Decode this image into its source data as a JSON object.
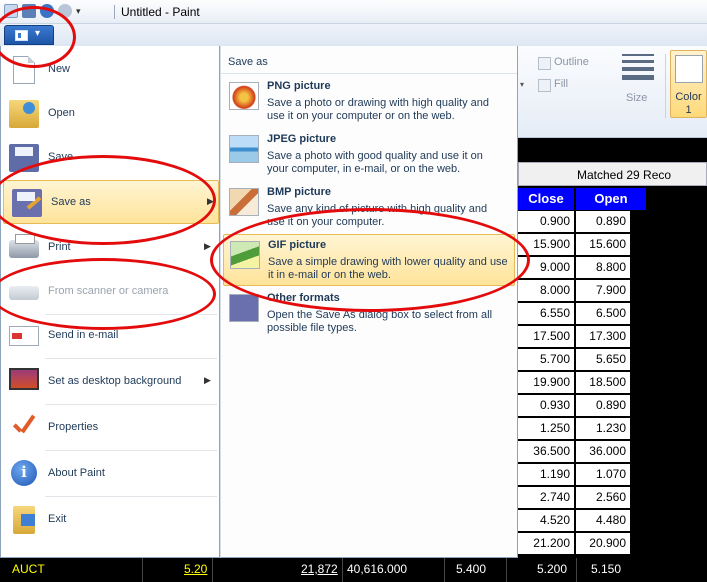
{
  "window": {
    "title": "Untitled - Paint"
  },
  "quick_access": {
    "icons": [
      "paint-doc-icon",
      "save-icon",
      "undo-icon",
      "redo-icon",
      "customize-arrow-icon"
    ]
  },
  "ribbon": {
    "outline_label": "Outline",
    "fill_label": "Fill",
    "size_label": "Size",
    "color1_label_line1": "Color",
    "color1_label_line2": "1"
  },
  "app_menu": {
    "items": [
      {
        "label": "New",
        "icon": "new-document-icon"
      },
      {
        "label": "Open",
        "icon": "open-folder-icon"
      },
      {
        "label": "Save",
        "icon": "save-icon"
      },
      {
        "label": "Save as",
        "icon": "save-as-icon",
        "selected": true,
        "submenu": true
      },
      {
        "label": "Print",
        "icon": "printer-icon",
        "submenu": true
      },
      {
        "label": "From scanner or camera",
        "icon": "scanner-icon",
        "disabled": true
      },
      {
        "label": "Send in e-mail",
        "icon": "email-icon"
      },
      {
        "label": "Set as desktop background",
        "icon": "desktop-icon",
        "submenu": true
      },
      {
        "label": "Properties",
        "icon": "checkmark-icon"
      },
      {
        "label": "About Paint",
        "icon": "info-icon"
      },
      {
        "label": "Exit",
        "icon": "exit-icon"
      }
    ]
  },
  "save_as": {
    "header": "Save as",
    "options": [
      {
        "title": "PNG picture",
        "description": "Save a photo or drawing with high quality and use it on your computer or on the web.",
        "icon": "png-picture-icon"
      },
      {
        "title": "JPEG picture",
        "description": "Save a photo with good quality and use it on your computer, in e-mail, or on the web.",
        "icon": "jpeg-picture-icon"
      },
      {
        "title": "BMP picture",
        "description": "Save any kind of picture with high quality and use it on your computer.",
        "icon": "bmp-picture-icon"
      },
      {
        "title": "GIF picture",
        "description": "Save a simple drawing with lower quality and use it in e-mail or on the web.",
        "icon": "gif-picture-icon",
        "selected": true
      },
      {
        "title": "Other formats",
        "description": "Open the Save As dialog box to select from all possible file types.",
        "icon": "other-formats-icon"
      }
    ]
  },
  "stock_table": {
    "matched_text": "Matched 29 Reco",
    "headers": [
      "Close",
      "Open"
    ],
    "rows": [
      [
        "0.900",
        "0.890"
      ],
      [
        "15.900",
        "15.600"
      ],
      [
        "9.000",
        "8.800"
      ],
      [
        "8.000",
        "7.900"
      ],
      [
        "6.550",
        "6.500"
      ],
      [
        "17.500",
        "17.300"
      ],
      [
        "5.700",
        "5.650"
      ],
      [
        "19.900",
        "18.500"
      ],
      [
        "0.930",
        "0.890"
      ],
      [
        "1.250",
        "1.230"
      ],
      [
        "36.500",
        "36.000"
      ],
      [
        "1.190",
        "1.070"
      ],
      [
        "2.740",
        "2.560"
      ],
      [
        "4.520",
        "4.480"
      ],
      [
        "21.200",
        "20.900"
      ]
    ],
    "bottom_row": {
      "symbol": "AUCT",
      "last": "5.20",
      "volume": "21,872",
      "value": "40,616.000",
      "change": "5.400",
      "close": "5.200",
      "open": "5.150"
    }
  },
  "annotation_color": "#e30b0b"
}
